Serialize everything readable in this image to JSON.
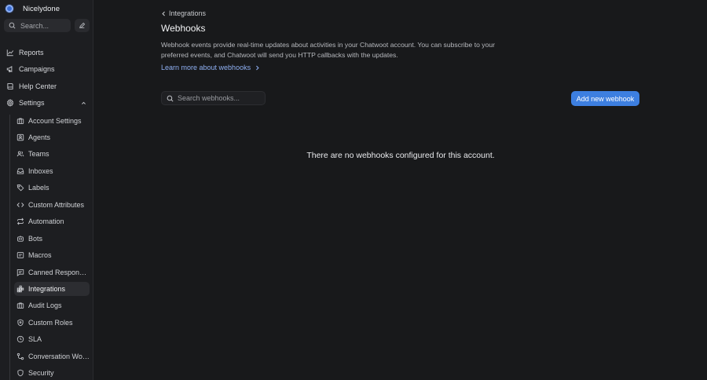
{
  "sidebar": {
    "account_name": "Nicelydone",
    "search_placeholder": "Search...",
    "items": [
      {
        "label": "Reports",
        "icon": "chart-line-icon"
      },
      {
        "label": "Campaigns",
        "icon": "megaphone-icon"
      },
      {
        "label": "Help Center",
        "icon": "book-icon"
      },
      {
        "label": "Settings",
        "icon": "gear-icon"
      }
    ],
    "settings_items": [
      {
        "label": "Account Settings",
        "icon": "briefcase-icon"
      },
      {
        "label": "Agents",
        "icon": "agent-icon"
      },
      {
        "label": "Teams",
        "icon": "team-icon"
      },
      {
        "label": "Inboxes",
        "icon": "inbox-icon"
      },
      {
        "label": "Labels",
        "icon": "tag-icon"
      },
      {
        "label": "Custom Attributes",
        "icon": "code-icon"
      },
      {
        "label": "Automation",
        "icon": "repeat-icon"
      },
      {
        "label": "Bots",
        "icon": "bot-icon"
      },
      {
        "label": "Macros",
        "icon": "macro-icon"
      },
      {
        "label": "Canned Responses",
        "icon": "message-icon"
      },
      {
        "label": "Integrations",
        "icon": "integration-icon"
      },
      {
        "label": "Audit Logs",
        "icon": "log-icon"
      },
      {
        "label": "Custom Roles",
        "icon": "shield-icon"
      },
      {
        "label": "SLA",
        "icon": "clock-icon"
      },
      {
        "label": "Conversation Workflows",
        "icon": "workflow-icon"
      },
      {
        "label": "Security",
        "icon": "lock-icon"
      }
    ],
    "active_item": "Integrations"
  },
  "main": {
    "breadcrumb": "Integrations",
    "title": "Webhooks",
    "description": "Webhook events provide real-time updates about activities in your Chatwoot account. You can subscribe to your preferred events, and Chatwoot will send you HTTP callbacks with the updates.",
    "learn_more": "Learn more about webhooks",
    "search_placeholder": "Search webhooks...",
    "add_button": "Add new webhook",
    "empty_message": "There are no webhooks configured for this account."
  },
  "colors": {
    "background": "#18191b",
    "sidebar": "#1d1e21",
    "accent": "#3d7fe0",
    "link": "#8fb0f3"
  }
}
